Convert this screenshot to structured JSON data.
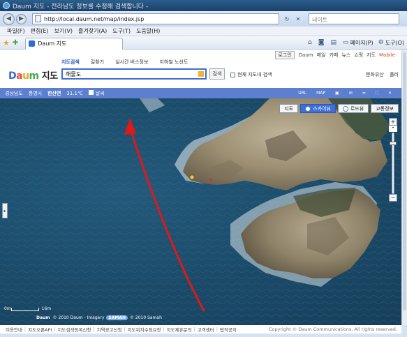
{
  "window": {
    "title": "Daum 지도 - 전라남도 정보를 수정해 검색합니다 -"
  },
  "address_bar": {
    "url": "http://local.daum.net/map/index.jsp",
    "search_placeholder": "네이트"
  },
  "menu": [
    "파일(F)",
    "편집(E)",
    "보기(V)",
    "즐겨찾기(A)",
    "도구(T)",
    "도움말(H)"
  ],
  "tab": {
    "label": "Daum 지도"
  },
  "command_bar": {
    "page_label": "페이지(P)",
    "tools_label": "도구(O)"
  },
  "daum": {
    "top_links": {
      "login": "로그인",
      "daum": "Daum",
      "mail": "메일",
      "cafe": "카페",
      "news": "뉴스",
      "shopping": "쇼핑",
      "map": "지도",
      "mobile": "Mobile"
    },
    "logo_text": "지도",
    "service_tabs": [
      "지도검색",
      "길찾기",
      "실시간 버스정보",
      "지하철 노선도"
    ],
    "search_value": "해물도",
    "search_button": "검색",
    "current_map_search": "현재 지도내 검색",
    "right_links": [
      "문화유산",
      "플러"
    ]
  },
  "region_bar": {
    "province": "경상남도",
    "city": "통영시",
    "district": "한산면",
    "temperature": "31.1℃",
    "weather": "날씨",
    "tools": [
      "URL",
      "MAP"
    ]
  },
  "map": {
    "type_buttons": [
      "지도",
      "스카이뷰",
      "로드뷰",
      "교통정보"
    ],
    "active_type": "스카이뷰",
    "scale_left": "0m",
    "scale_right": "16m",
    "copyright": "© 2010 Daum - Imagery",
    "copyright_badge": "SAMAH",
    "copyright_tail": "© 2010 Samah"
  },
  "footer": {
    "links": [
      "이용안내",
      "지도오픈API",
      "지도검색등록신청",
      "지역광고신청",
      "지도위치수정요청",
      "지도제휴문의",
      "고객센터",
      "법적공지"
    ],
    "copyright": "Copyright © Daum Communications. All rights reserved."
  }
}
